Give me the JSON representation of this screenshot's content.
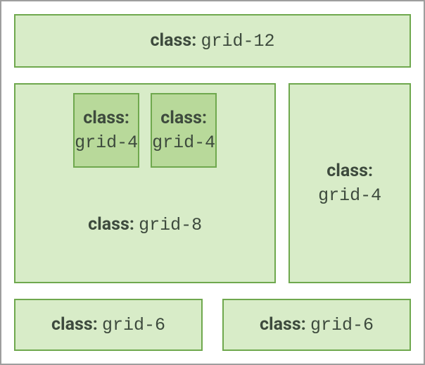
{
  "labelKey": "class:",
  "top": {
    "value": "grid-12"
  },
  "middle": {
    "container": {
      "value": "grid-8"
    },
    "innerLeft": {
      "value": "grid-4"
    },
    "innerRight": {
      "value": "grid-4"
    },
    "side": {
      "value": "grid-4"
    }
  },
  "bottom": {
    "left": {
      "value": "grid-6"
    },
    "right": {
      "value": "grid-6"
    }
  }
}
